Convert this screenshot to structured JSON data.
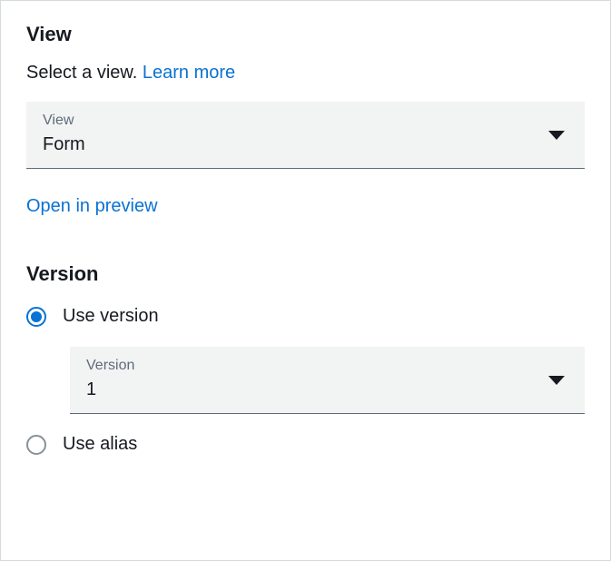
{
  "view": {
    "heading": "View",
    "subtitle": "Select a view.",
    "learn_more_label": "Learn more",
    "select_label": "View",
    "select_value": "Form",
    "preview_link": "Open in preview"
  },
  "version": {
    "heading": "Version",
    "option_use_version": "Use version",
    "option_use_alias": "Use alias",
    "selected": "use_version",
    "select_label": "Version",
    "select_value": "1"
  }
}
